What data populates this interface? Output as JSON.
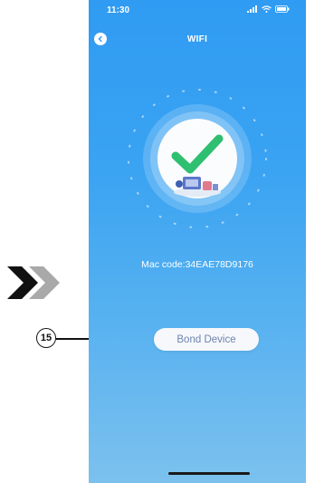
{
  "status_bar": {
    "time": "11:30",
    "icons": [
      "signal-icon",
      "wifi-icon",
      "battery-icon"
    ]
  },
  "header": {
    "title": "WIFI",
    "back_icon": "back-arrow-icon"
  },
  "main": {
    "graphic_icon": "success-checkmark-icon",
    "mac_text": "Mac code:34EAE78D9176",
    "bond_label": "Bond Device"
  },
  "annotations": {
    "callout_number": "15",
    "arrow_icon": "double-chevron-right-icon"
  },
  "colors": {
    "accent_blue": "#2f9bf2",
    "check_green": "#2fbf71",
    "button_text": "#6f84b0",
    "button_bg": "#f6f8fb"
  }
}
